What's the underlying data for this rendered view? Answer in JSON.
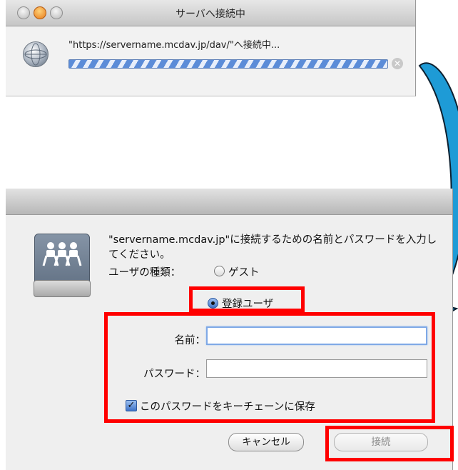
{
  "connecting_window": {
    "title": "サーバへ接続中",
    "status_text": "\"https://servername.mcdav.jp/dav/\"へ接続中...",
    "progress_state": "indeterminate",
    "icons": [
      "globe-icon",
      "stop-icon"
    ]
  },
  "login_window": {
    "message": "\"servername.mcdav.jp\"に接続するための名前とパスワードを入力してください。",
    "user_type_label": "ユーザの種類：",
    "options": {
      "guest": "ゲスト",
      "registered": "登録ユーザ",
      "selected": "registered"
    },
    "name_label": "名前：",
    "name_value": "",
    "password_label": "パスワード：",
    "password_value": "",
    "keychain_label": "このパスワードをキーチェーンに保存",
    "keychain_checked": true,
    "cancel_label": "キャンセル",
    "connect_label": "接続",
    "icons": [
      "server-icon"
    ]
  },
  "annotation": {
    "highlight_color": "#ff0000",
    "arrow_color": "#1e9bd6"
  }
}
